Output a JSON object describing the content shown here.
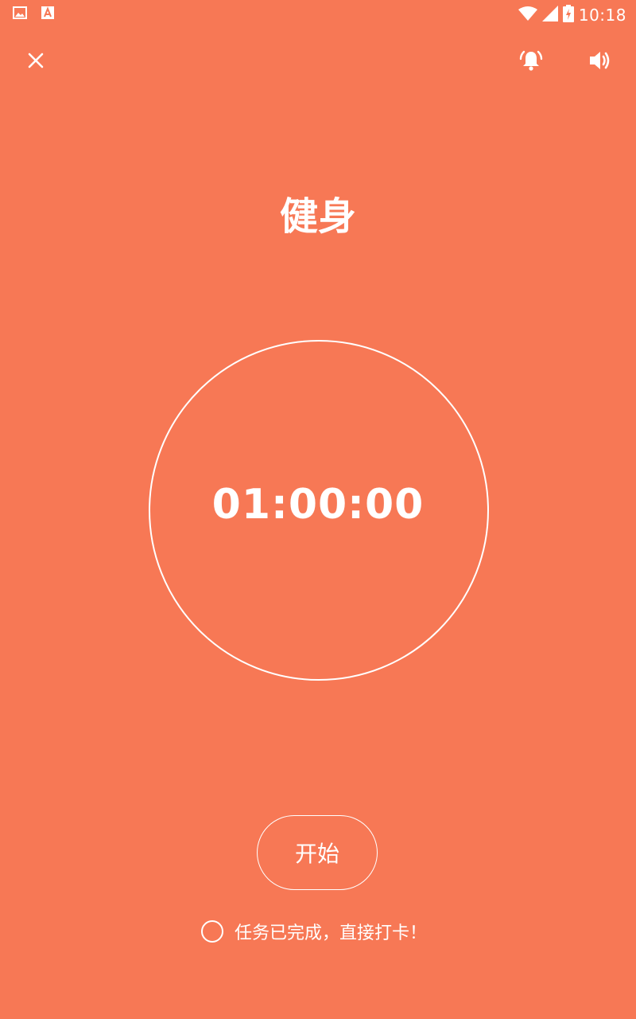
{
  "status_bar": {
    "time": "10:18",
    "icons": [
      "gallery-icon",
      "app-a-icon",
      "wifi-icon",
      "signal-icon",
      "battery-charging-icon"
    ]
  },
  "toolbar": {
    "close_icon": "close-icon",
    "alarm_icon": "alarm-bell-icon",
    "sound_icon": "volume-icon"
  },
  "task": {
    "title": "健身",
    "timer": "01:00:00"
  },
  "actions": {
    "start_label": "开始",
    "checkin_label": "任务已完成，直接打卡！"
  },
  "colors": {
    "background": "#F77855",
    "foreground": "#FFFFFF"
  }
}
